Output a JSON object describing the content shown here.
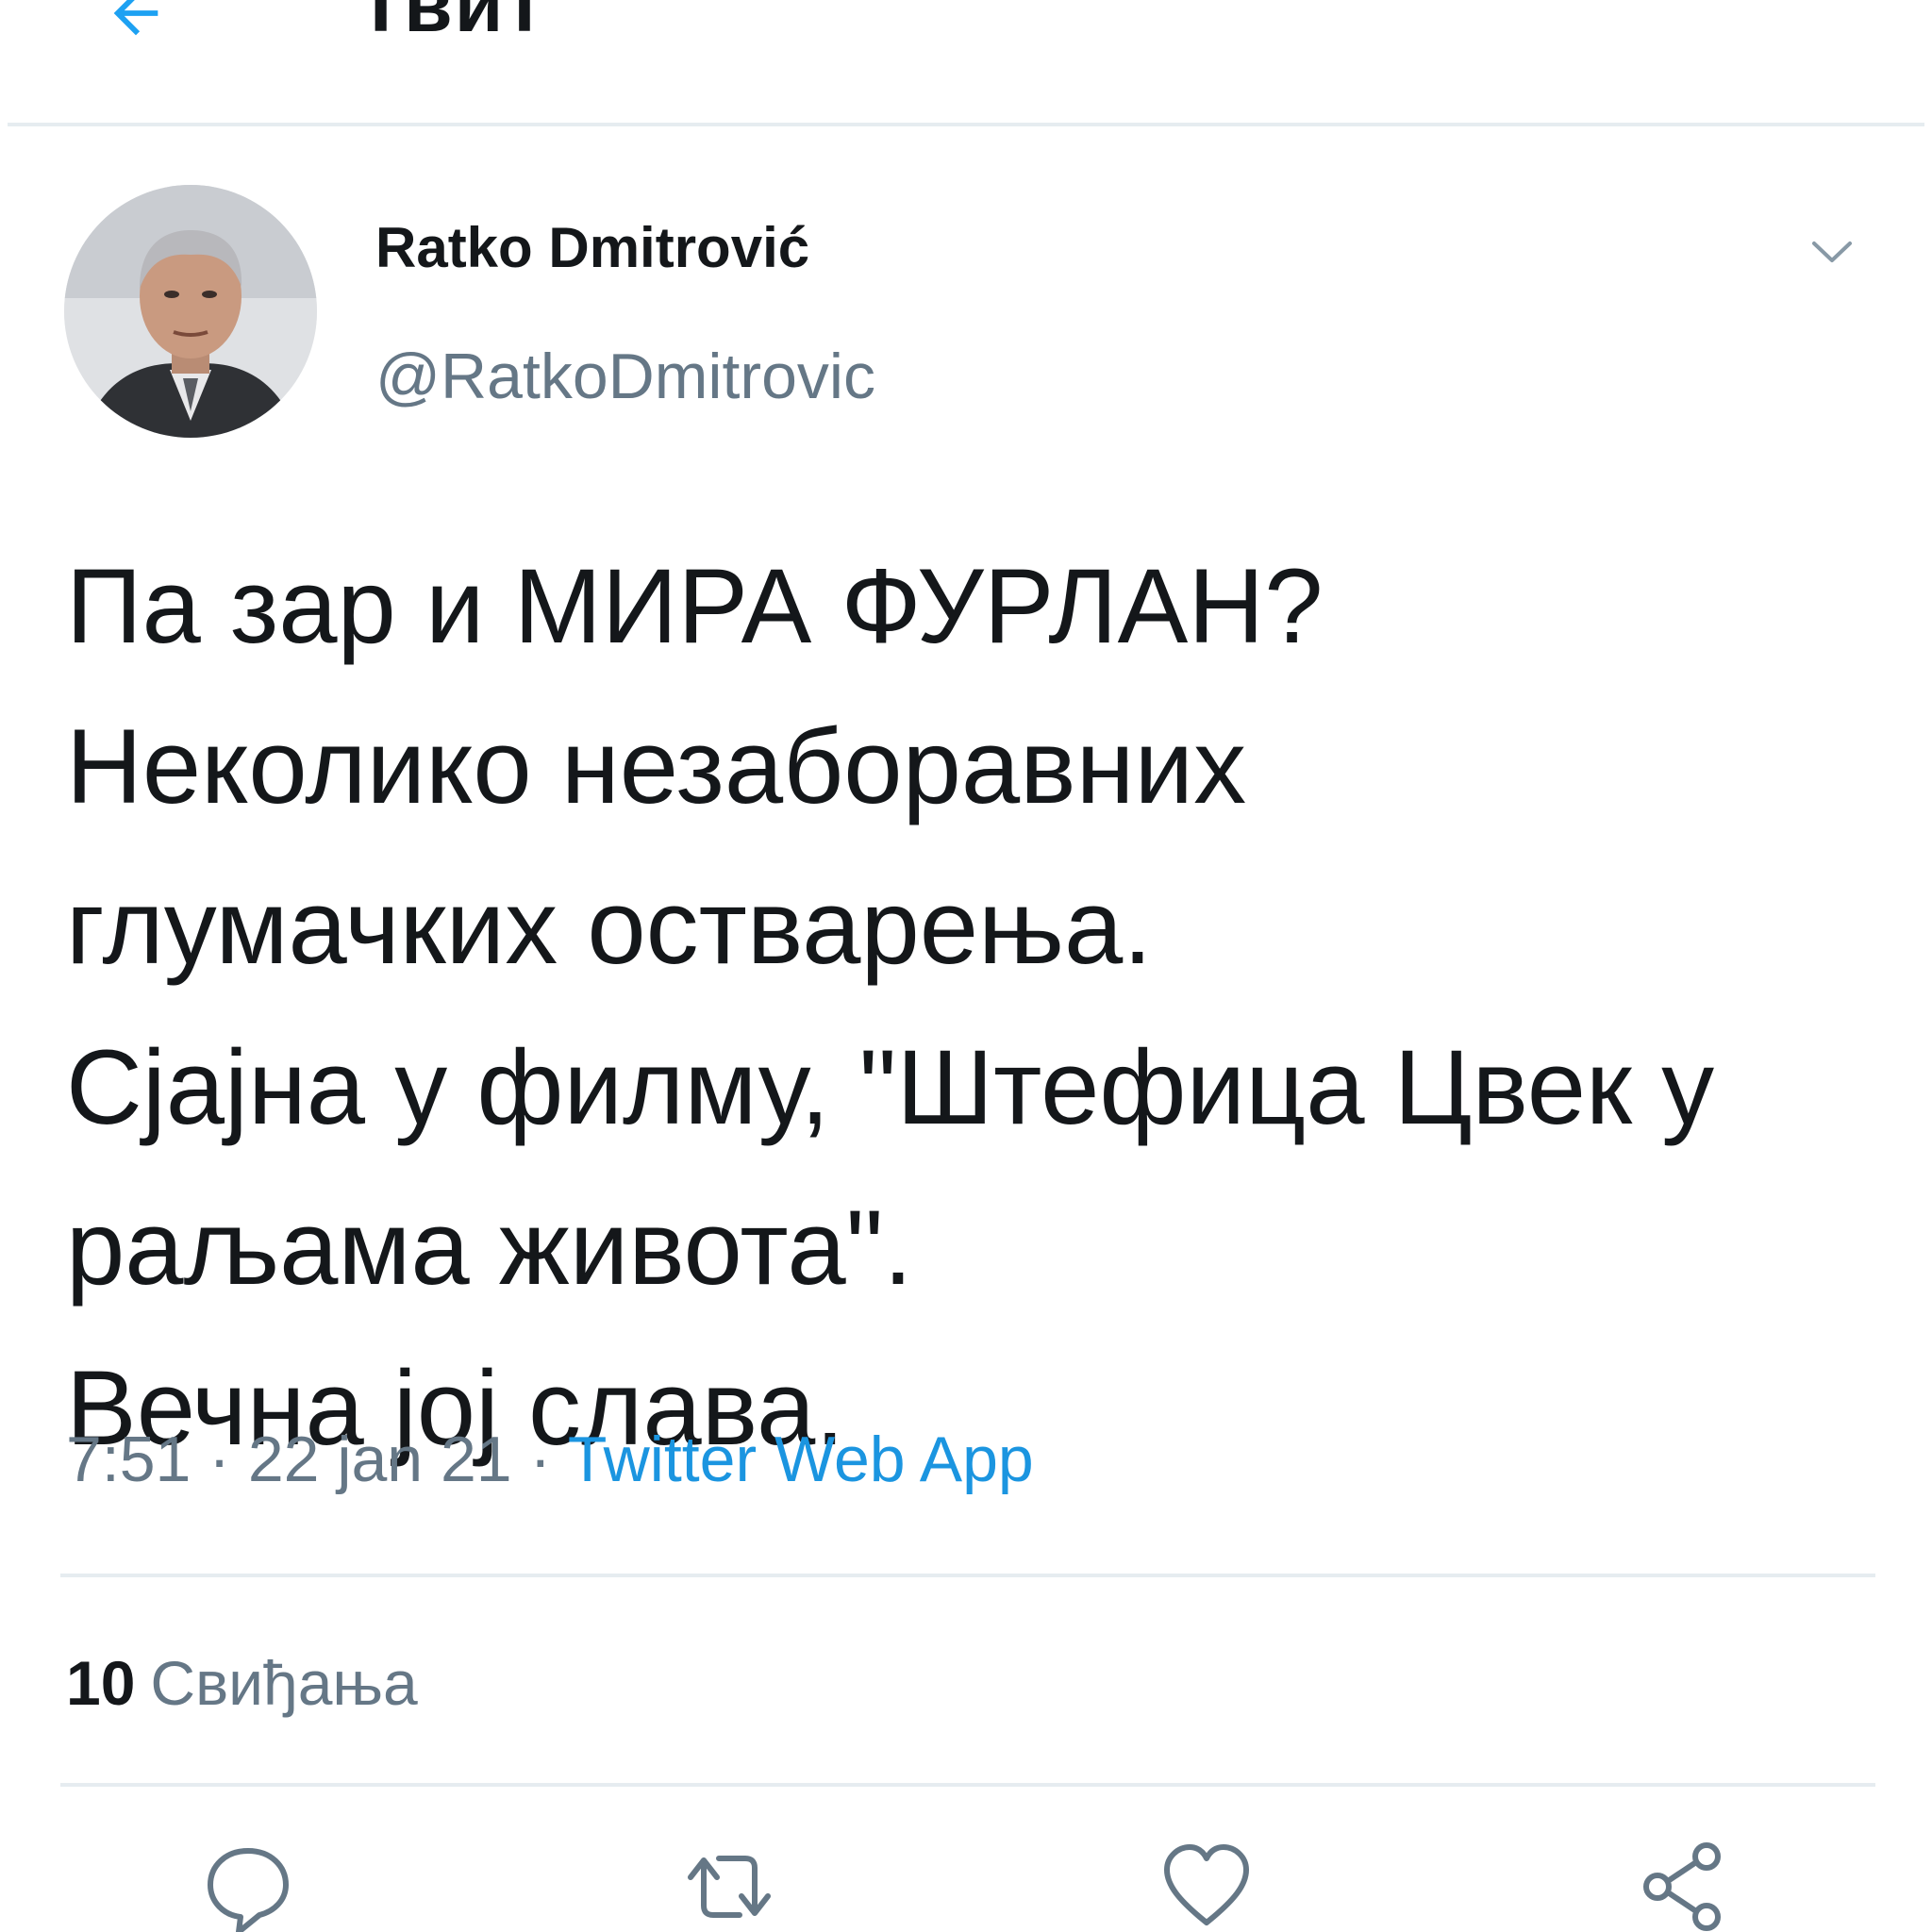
{
  "header": {
    "title": "Твит",
    "back_icon": "arrow-left-icon"
  },
  "author": {
    "name": "Ratko Dmitrović",
    "handle": "@RatkoDmitrovic",
    "avatar_icon": "profile-photo"
  },
  "tweet": {
    "lines": [
      "Па зар и МИРА ФУРЛАН?",
      "Неколико незаборавних",
      "глумачких остварења.",
      "Сјајна у филму, \"Штефица Цвек у",
      "раљама живота\".",
      "Вечна јој слава."
    ],
    "time": "7:51",
    "date": "22 jan 21",
    "separator": "·",
    "source": "Twitter Web App"
  },
  "stats": {
    "likes_count": "10",
    "likes_label": "Свиђања"
  },
  "actions": [
    {
      "name": "reply",
      "icon": "reply-icon"
    },
    {
      "name": "retweet",
      "icon": "retweet-icon"
    },
    {
      "name": "like",
      "icon": "heart-icon"
    },
    {
      "name": "share",
      "icon": "share-icon"
    }
  ],
  "colors": {
    "text": "#14171a",
    "secondary": "#657786",
    "link": "#1b95e0",
    "divider": "#e6ecf0",
    "icon": "#657786"
  }
}
